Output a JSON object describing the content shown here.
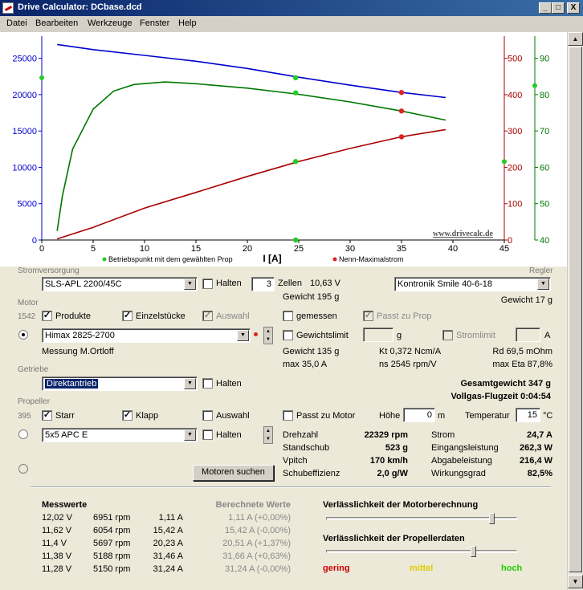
{
  "window": {
    "title": "Drive Calculator: DCbase.dcd",
    "btn_min": "_",
    "btn_max": "□",
    "btn_close": "X"
  },
  "menu": [
    "Datei",
    "Bearbeiten",
    "Werkzeuge",
    "Fenster",
    "Help"
  ],
  "chart_data": {
    "type": "line",
    "xlabel": "I [A]",
    "xlim": [
      0,
      45
    ],
    "x_ticks": [
      "0",
      "5",
      "10",
      "15",
      "20",
      "25",
      "30",
      "35",
      "40",
      "45"
    ],
    "y_left_ticks": [
      "0",
      "5000",
      "10000",
      "15000",
      "20000",
      "25000"
    ],
    "y_left_lim": [
      0,
      27500
    ],
    "y_right1_ticks": [
      "0",
      "100",
      "200",
      "300",
      "400",
      "500"
    ],
    "y_right1_lim": [
      0,
      550
    ],
    "y_right2_ticks": [
      "40",
      "50",
      "60",
      "70",
      "80",
      "90"
    ],
    "y_right2_lim": [
      40,
      95
    ],
    "watermark": "www.drivecalc.de",
    "legend": [
      {
        "label": "Betriebspunkt mit dem gewählten Prop",
        "color": "#22cc22"
      },
      {
        "label": "Nenn-Maximalstrom",
        "color": "#dd2222"
      }
    ],
    "series": [
      {
        "axis": "left",
        "color": "#0000cc",
        "points": [
          [
            1.5,
            26900
          ],
          [
            5,
            26200
          ],
          [
            10,
            25400
          ],
          [
            15,
            24600
          ],
          [
            20,
            23600
          ],
          [
            25,
            22400
          ],
          [
            30,
            21300
          ],
          [
            35,
            20300
          ],
          [
            39.3,
            19600
          ]
        ]
      },
      {
        "axis": "right1",
        "color": "#aa0000",
        "points": [
          [
            1.5,
            3
          ],
          [
            5,
            35
          ],
          [
            10,
            88
          ],
          [
            15,
            131
          ],
          [
            20,
            175
          ],
          [
            25,
            216
          ],
          [
            30,
            252
          ],
          [
            35,
            284
          ],
          [
            39.3,
            304
          ]
        ]
      },
      {
        "axis": "right2",
        "color": "#007700",
        "points": [
          [
            1.5,
            42.5
          ],
          [
            2,
            52
          ],
          [
            3,
            65
          ],
          [
            5,
            76
          ],
          [
            7,
            81
          ],
          [
            9,
            82.8
          ],
          [
            12,
            83.5
          ],
          [
            15,
            83
          ],
          [
            20,
            81.8
          ],
          [
            25,
            80.1
          ],
          [
            30,
            78
          ],
          [
            35,
            75.5
          ],
          [
            39.3,
            73
          ]
        ]
      }
    ],
    "markers": [
      {
        "axis": "left",
        "x": 24.7,
        "y": 22329,
        "color": "#22cc22"
      },
      {
        "axis": "right2",
        "x": 24.7,
        "y": 80.5,
        "color": "#22cc22"
      },
      {
        "axis": "right1",
        "x": 24.7,
        "y": 216,
        "color": "#22cc22"
      },
      {
        "axis": "right1",
        "x": 24.7,
        "y": 0,
        "color": "#22cc22"
      },
      {
        "axis": "left",
        "x": 35,
        "y": 20300,
        "color": "#dd2222"
      },
      {
        "axis": "right2",
        "x": 35,
        "y": 75.5,
        "color": "#dd2222"
      },
      {
        "axis": "right1",
        "x": 35,
        "y": 284,
        "color": "#dd2222"
      }
    ],
    "edge_markers": [
      {
        "axis": "left",
        "y": 22329,
        "side": "left",
        "color": "#22cc22"
      },
      {
        "axis": "right1",
        "y": 216,
        "side": "right1",
        "color": "#22cc22"
      },
      {
        "axis": "right2",
        "y": 82.5,
        "side": "right2",
        "color": "#22cc22"
      }
    ]
  },
  "strom": {
    "group": "Stromversorgung",
    "regler_group": "Regler",
    "battery": "SLS-APL 2200/45C",
    "halten": "Halten",
    "cells": "3",
    "zellen": "Zellen",
    "voltage": "10,63 V",
    "weight": "Gewicht 195 g",
    "regler": "Kontronik Smile 40-6-18",
    "regler_weight": "Gewicht 17 g"
  },
  "motor": {
    "group": "Motor",
    "count": "1542",
    "produkte": "Produkte",
    "einzelstuecke": "Einzelstücke",
    "auswahl": "Auswahl",
    "gemessen": "gemessen",
    "passt_prop": "Passt zu Prop",
    "name": "Himax 2825-2700",
    "gewichtslimit": "Gewichtslimit",
    "g_unit": "g",
    "stromlimit": "Stromlimit",
    "a_unit": "A",
    "messung": "Messung M.Ortloff",
    "gewicht": "Gewicht 135 g",
    "kt": "Kt 0,372 Ncm/A",
    "rd": "Rd 69,5 mOhm",
    "max_a": "max 35,0 A",
    "ns": "ns 2545 rpm/V",
    "max_eta": "max Eta 87,8%"
  },
  "getriebe": {
    "group": "Getriebe",
    "value": "Direktantrieb",
    "halten": "Halten",
    "gesamtgewicht": "Gesamtgewicht 347 g",
    "flugzeit": "Vollgas-Flugzeit 0:04:54"
  },
  "propeller": {
    "group": "Propeller",
    "count": "395",
    "starr": "Starr",
    "klapp": "Klapp",
    "auswahl": "Auswahl",
    "passt_motor": "Passt zu Motor",
    "hoehe_label": "Höhe",
    "hoehe": "0",
    "m_unit": "m",
    "temp_label": "Temperatur",
    "temp": "15",
    "c_unit": "°C",
    "name": "5x5 APC E",
    "halten": "Halten",
    "motoren_suchen": "Motoren suchen"
  },
  "results": {
    "drehzahl_l": "Drehzahl",
    "drehzahl": "22329 rpm",
    "standschub_l": "Standschub",
    "standschub": "523 g",
    "vpitch_l": "Vpitch",
    "vpitch": "170 km/h",
    "schub_l": "Schubeffizienz",
    "schub": "2,0 g/W",
    "strom_l": "Strom",
    "strom": "24,7 A",
    "ein_l": "Eingangsleistung",
    "ein": "262,3 W",
    "ab_l": "Abgabeleistung",
    "ab": "216,4 W",
    "wg_l": "Wirkungsgrad",
    "wg": "82,5%"
  },
  "messwerte": {
    "header": "Messwerte",
    "header_calc": "Berechnete Werte",
    "rows": [
      {
        "v": "12,02 V",
        "rpm": "6951 rpm",
        "a": "1,11 A",
        "calc": "1,11 A (+0,00%)"
      },
      {
        "v": "11,62 V",
        "rpm": "6054 rpm",
        "a": "15,42 A",
        "calc": "15,42 A (-0,00%)"
      },
      {
        "v": "11,4 V",
        "rpm": "5697 rpm",
        "a": "20,23 A",
        "calc": "20,51 A (+1,37%)"
      },
      {
        "v": "11,38 V",
        "rpm": "5188 rpm",
        "a": "31,46 A",
        "calc": "31,66 A (+0,63%)"
      },
      {
        "v": "11,28 V",
        "rpm": "5150 rpm",
        "a": "31,24 A",
        "calc": "31,24 A (-0,00%)"
      }
    ]
  },
  "reliability": {
    "motor_label": "Verlässlichkeit der Motorberechnung",
    "prop_label": "Verlässlichkeit der Propellerdaten",
    "gering": "gering",
    "mittel": "mittel",
    "hoch": "hoch",
    "gering_color": "#cc0000",
    "mittel_color": "#ddcc00",
    "hoch_color": "#22cc00"
  }
}
